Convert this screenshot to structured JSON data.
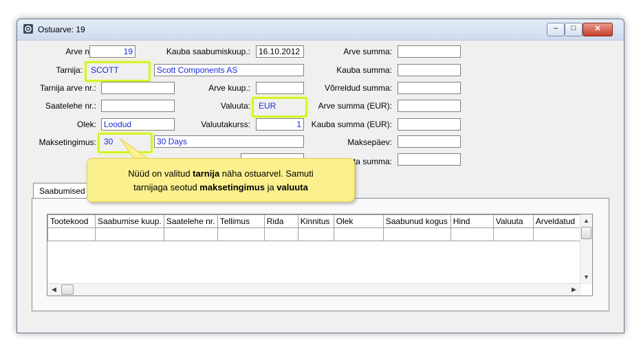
{
  "window": {
    "title": "Ostuarve: 19",
    "minimize_glyph": "–",
    "maximize_glyph": "□",
    "close_glyph": "✕"
  },
  "form": {
    "arve_nr_label": "Arve nr.:",
    "arve_nr": "19",
    "kauba_saabumiskuup_label": "Kauba saabumiskuup.:",
    "kauba_saabumiskuup": "16.10.2012",
    "arve_summa_label": "Arve summa:",
    "arve_summa": "",
    "tarnija_label": "Tarnija:",
    "tarnija_code": "SCOTT",
    "tarnija_name": "Scott Components AS",
    "kauba_summa_label": "Kauba summa:",
    "kauba_summa": "",
    "tarnija_arve_nr_label": "Tarnija arve nr.:",
    "tarnija_arve_nr": "",
    "arve_kuup_label": "Arve kuup.:",
    "arve_kuup": "",
    "vorreldud_summa_label": "Võrreldud summa:",
    "vorreldud_summa": "",
    "saatelehe_nr_label": "Saatelehe nr.:",
    "saatelehe_nr": "",
    "valuuta_label": "Valuuta:",
    "valuuta": "EUR",
    "arve_summa_eur_label": "Arve summa (EUR):",
    "arve_summa_eur": "",
    "olek_label": "Olek:",
    "olek": "Loodud",
    "valuutakurss_label": "Valuutakurss:",
    "valuutakurss": "1",
    "kauba_summa_eur_label": "Kauba summa (EUR):",
    "kauba_summa_eur": "",
    "maksetingimus_label": "Maksetingimus:",
    "maksetingimus_code": "30",
    "maksetingimus_name": "30 Days",
    "maksepaev_label": "Maksepäev:",
    "maksepaev": "",
    "hidden_summa_label": "ata summa:",
    "hidden_summa": ""
  },
  "callout": {
    "part1": "Nüüd on valitud ",
    "bold1": "tarnija",
    "part2": " näha ostuarvel. Samuti",
    "part3": "tarnijaga seotud ",
    "bold2": "maksetingimus",
    "part4": " ja ",
    "bold3": "valuuta"
  },
  "tabs": {
    "saabumised": "Saabumised"
  },
  "grid": {
    "columns": [
      "Tootekood",
      "Saabumise kuup.",
      "Saatelehe nr.",
      "Tellimus",
      "Rida",
      "Kinnitus",
      "Olek",
      "Saabunud kogus",
      "Hind",
      "Valuuta",
      "Arveldatud"
    ]
  },
  "colors": {
    "highlight": "#d8f227",
    "callout": "#fbf08e",
    "link_blue": "#1a2bd6"
  }
}
